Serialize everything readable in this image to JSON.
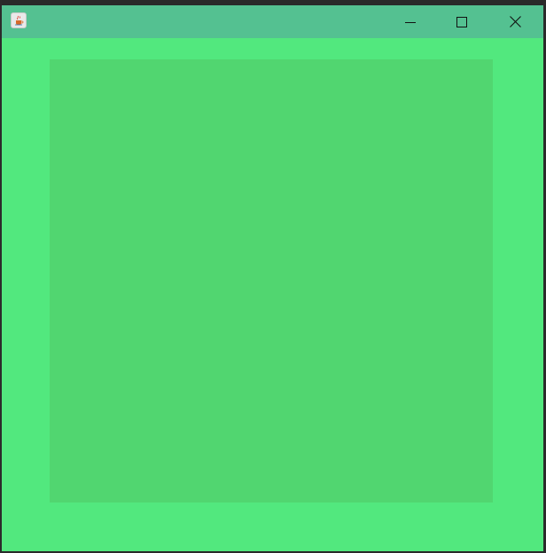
{
  "window": {
    "title": "",
    "app_icon": "java-cup-icon",
    "controls": {
      "minimize_icon": "minimize-icon",
      "maximize_icon": "maximize-icon",
      "close_icon": "close-icon"
    }
  },
  "colors": {
    "frame_background": "#52e87e",
    "title_bar": "#54c191",
    "content_panel": "#51d670",
    "desktop": "#2b2b2b"
  }
}
